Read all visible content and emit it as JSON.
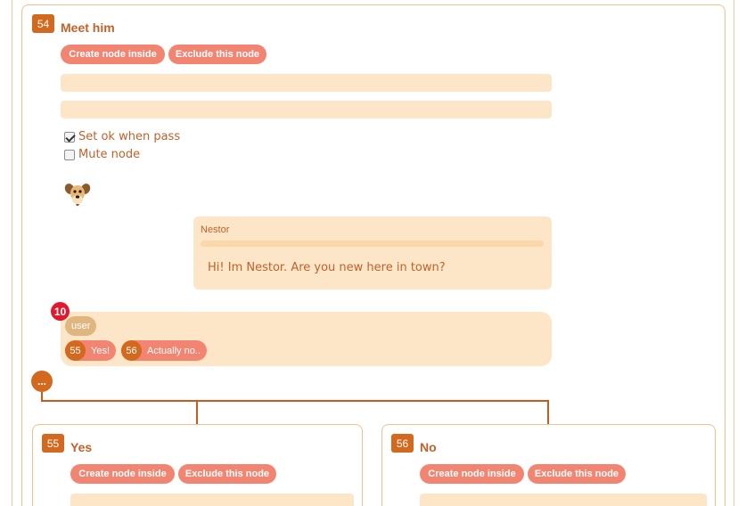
{
  "main_node": {
    "id": "54",
    "title": "Meet him",
    "create_label": "Create node inside",
    "exclude_label": "Exclude this node",
    "options": [
      {
        "label": "Set ok when pass",
        "checked": true
      },
      {
        "label": "Mute node",
        "checked": false
      }
    ],
    "avatar_icon": "dog-avatar-icon",
    "message": {
      "speaker": "Nestor",
      "text": "Hi! Im Nestor. Are you new here in town?"
    },
    "response": {
      "notification_count": "10",
      "actor_tag": "user",
      "choices": [
        {
          "num": "55",
          "label": "Yes!"
        },
        {
          "num": "56",
          "label": "Actually no.."
        }
      ]
    },
    "more_label": "..."
  },
  "child_nodes": [
    {
      "id": "55",
      "title": "Yes",
      "create_label": "Create node inside",
      "exclude_label": "Exclude this node"
    },
    {
      "id": "56",
      "title": "No",
      "create_label": "Create node inside",
      "exclude_label": "Exclude this node"
    }
  ],
  "colors": {
    "accent": "#d2691e",
    "button": "#f28571",
    "field": "#fde6c8",
    "text": "#c0622a",
    "notification": "#e0192f"
  }
}
